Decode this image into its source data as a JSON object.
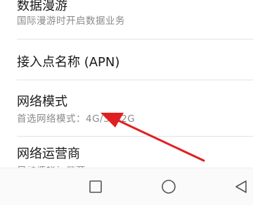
{
  "settings": {
    "items": [
      {
        "title": "数据漫游",
        "subtitle": "国际漫游时开启数据业务"
      },
      {
        "title": "接入点名称 (APN)",
        "subtitle": ""
      },
      {
        "title": "网络模式",
        "subtitle": "首选网络模式：4G/3G/2G"
      },
      {
        "title": "网络运营商",
        "subtitle": "自动选择运营商"
      }
    ]
  },
  "navbar": {
    "recent_icon": "square-icon",
    "home_icon": "circle-icon",
    "back_icon": "triangle-back-icon"
  },
  "annotation": {
    "arrow_color": "#e02020"
  }
}
